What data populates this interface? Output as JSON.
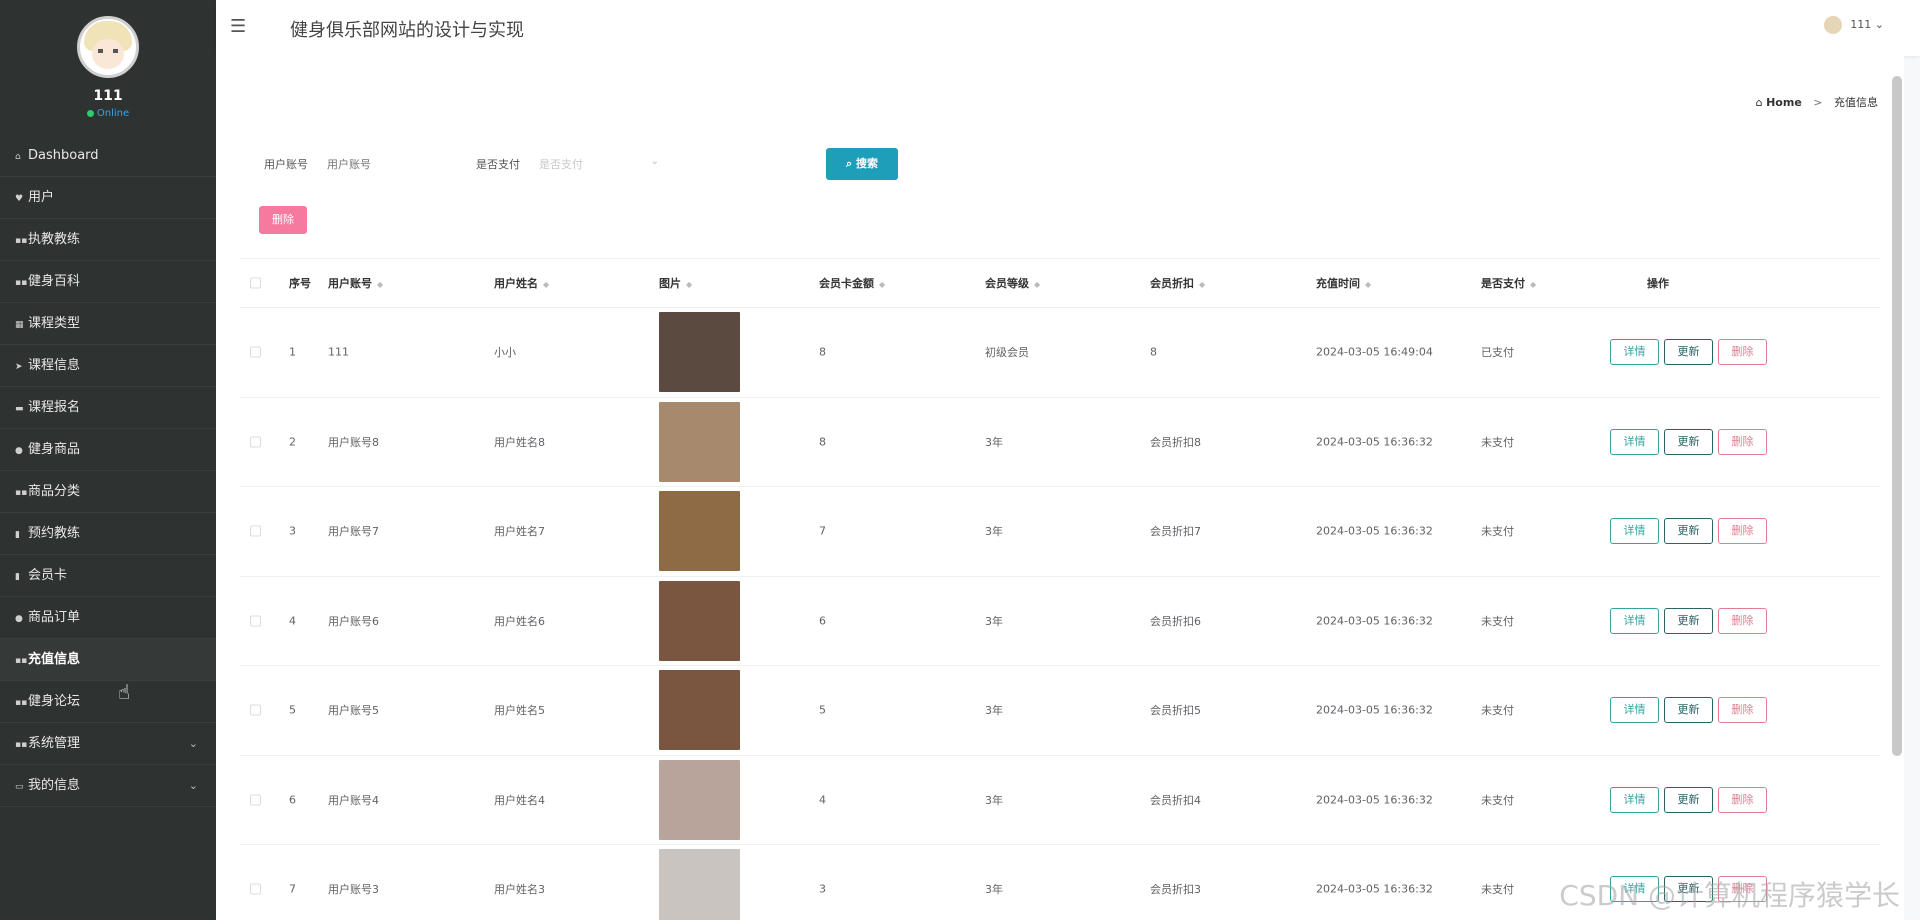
{
  "sidebar": {
    "username": "111",
    "status": "Online",
    "items": [
      {
        "label": "Dashboard",
        "icon": "home-icon",
        "glyph": "⌂"
      },
      {
        "label": "用户",
        "icon": "user-icon",
        "glyph": "♥"
      },
      {
        "label": "执教教练",
        "icon": "grid-icon",
        "glyph": "▪▪"
      },
      {
        "label": "健身百科",
        "icon": "grid-icon",
        "glyph": "▪▪"
      },
      {
        "label": "课程类型",
        "icon": "list-icon",
        "glyph": "▦"
      },
      {
        "label": "课程信息",
        "icon": "send-icon",
        "glyph": "➤"
      },
      {
        "label": "课程报名",
        "icon": "briefcase-icon",
        "glyph": "▬"
      },
      {
        "label": "健身商品",
        "icon": "person-icon",
        "glyph": "●"
      },
      {
        "label": "商品分类",
        "icon": "grid-icon",
        "glyph": "▪▪"
      },
      {
        "label": "预约教练",
        "icon": "chart-icon",
        "glyph": "▮"
      },
      {
        "label": "会员卡",
        "icon": "trash-icon",
        "glyph": "▮"
      },
      {
        "label": "商品订单",
        "icon": "pin-icon",
        "glyph": "●"
      },
      {
        "label": "充值信息",
        "icon": "grid-icon",
        "glyph": "▪▪"
      },
      {
        "label": "健身论坛",
        "icon": "grid-icon",
        "glyph": "▪▪"
      },
      {
        "label": "系统管理",
        "icon": "grid-icon",
        "glyph": "▪▪"
      },
      {
        "label": "我的信息",
        "icon": "card-icon",
        "glyph": "▭"
      }
    ],
    "active_label": "充值信息"
  },
  "topbar": {
    "title": "健身俱乐部网站的设计与实现",
    "user": "111"
  },
  "breadcrumb": {
    "home": "Home",
    "separator": ">",
    "current": "充值信息"
  },
  "search": {
    "account_label": "用户账号",
    "account_placeholder": "用户账号",
    "paid_label": "是否支付",
    "paid_placeholder": "是否支付",
    "search_button": "搜索",
    "delete_button": "删除"
  },
  "table": {
    "headers": {
      "index": "序号",
      "account": "用户账号",
      "name": "用户姓名",
      "image": "图片",
      "amount": "会员卡金额",
      "level": "会员等级",
      "discount": "会员折扣",
      "time": "充值时间",
      "paid": "是否支付",
      "ops": "操作"
    },
    "op_labels": {
      "detail": "详情",
      "update": "更新",
      "delete": "删除"
    },
    "rows": [
      {
        "index": "1",
        "account": "111",
        "name": "小小",
        "amount": "8",
        "level": "初级会员",
        "discount": "8",
        "time": "2024-03-05 16:49:04",
        "paid": "已支付",
        "thumb": "#5a4a3f"
      },
      {
        "index": "2",
        "account": "用户账号8",
        "name": "用户姓名8",
        "amount": "8",
        "level": "3年",
        "discount": "会员折扣8",
        "time": "2024-03-05 16:36:32",
        "paid": "未支付",
        "thumb": "#a78a6d"
      },
      {
        "index": "3",
        "account": "用户账号7",
        "name": "用户姓名7",
        "amount": "7",
        "level": "3年",
        "discount": "会员折扣7",
        "time": "2024-03-05 16:36:32",
        "paid": "未支付",
        "thumb": "#8f6b45"
      },
      {
        "index": "4",
        "account": "用户账号6",
        "name": "用户姓名6",
        "amount": "6",
        "level": "3年",
        "discount": "会员折扣6",
        "time": "2024-03-05 16:36:32",
        "paid": "未支付",
        "thumb": "#7a5640"
      },
      {
        "index": "5",
        "account": "用户账号5",
        "name": "用户姓名5",
        "amount": "5",
        "level": "3年",
        "discount": "会员折扣5",
        "time": "2024-03-05 16:36:32",
        "paid": "未支付",
        "thumb": "#7a5640"
      },
      {
        "index": "6",
        "account": "用户账号4",
        "name": "用户姓名4",
        "amount": "4",
        "level": "3年",
        "discount": "会员折扣4",
        "time": "2024-03-05 16:36:32",
        "paid": "未支付",
        "thumb": "#b8a49a"
      },
      {
        "index": "7",
        "account": "用户账号3",
        "name": "用户姓名3",
        "amount": "3",
        "level": "3年",
        "discount": "会员折扣3",
        "time": "2024-03-05 16:36:32",
        "paid": "未支付",
        "thumb": "#c9c4bf"
      }
    ]
  },
  "watermark": "CSDN @计算机程序猿学长",
  "colors": {
    "sidebar_bg": "#2e3332",
    "accent": "#1e9eb8",
    "danger": "#f57aa0",
    "detail": "#35a4a0",
    "update": "#2b6366",
    "delete": "#e07d8f"
  }
}
